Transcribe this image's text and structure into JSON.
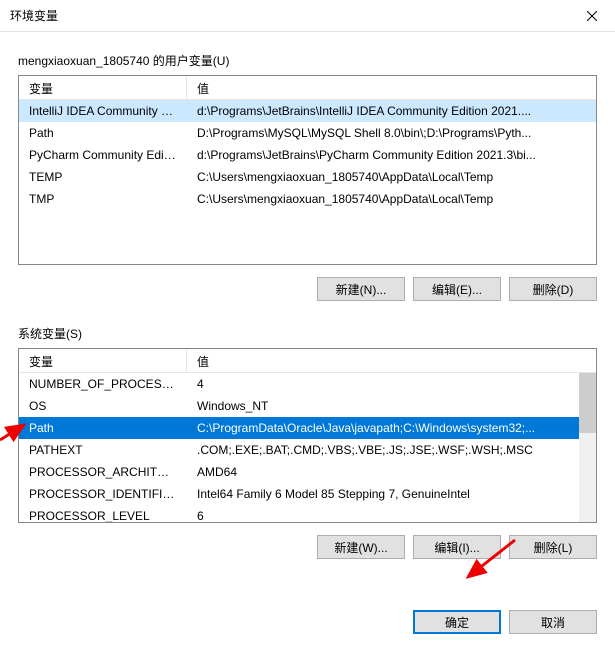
{
  "titlebar": {
    "title": "环境变量"
  },
  "user": {
    "section_label": "mengxiaoxuan_1805740 的用户变量(U)",
    "cols": {
      "var": "变量",
      "val": "值"
    },
    "rows": [
      {
        "var": "IntelliJ IDEA Community E...",
        "val": "d:\\Programs\\JetBrains\\IntelliJ IDEA Community Edition 2021...."
      },
      {
        "var": "Path",
        "val": "D:\\Programs\\MySQL\\MySQL Shell 8.0\\bin\\;D:\\Programs\\Pyth..."
      },
      {
        "var": "PyCharm Community Editi...",
        "val": "d:\\Programs\\JetBrains\\PyCharm Community Edition 2021.3\\bi..."
      },
      {
        "var": "TEMP",
        "val": "C:\\Users\\mengxiaoxuan_1805740\\AppData\\Local\\Temp"
      },
      {
        "var": "TMP",
        "val": "C:\\Users\\mengxiaoxuan_1805740\\AppData\\Local\\Temp"
      }
    ],
    "buttons": {
      "new": "新建(N)...",
      "edit": "编辑(E)...",
      "delete": "删除(D)"
    }
  },
  "system": {
    "section_label": "系统变量(S)",
    "cols": {
      "var": "变量",
      "val": "值"
    },
    "rows": [
      {
        "var": "NUMBER_OF_PROCESSORS",
        "val": "4"
      },
      {
        "var": "OS",
        "val": "Windows_NT"
      },
      {
        "var": "Path",
        "val": "C:\\ProgramData\\Oracle\\Java\\javapath;C:\\Windows\\system32;..."
      },
      {
        "var": "PATHEXT",
        "val": ".COM;.EXE;.BAT;.CMD;.VBS;.VBE;.JS;.JSE;.WSF;.WSH;.MSC"
      },
      {
        "var": "PROCESSOR_ARCHITECT...",
        "val": "AMD64"
      },
      {
        "var": "PROCESSOR_IDENTIFIER",
        "val": "Intel64 Family 6 Model 85 Stepping 7, GenuineIntel"
      },
      {
        "var": "PROCESSOR_LEVEL",
        "val": "6"
      }
    ],
    "buttons": {
      "new": "新建(W)...",
      "edit": "编辑(I)...",
      "delete": "删除(L)"
    }
  },
  "dialog": {
    "ok": "确定",
    "cancel": "取消"
  }
}
